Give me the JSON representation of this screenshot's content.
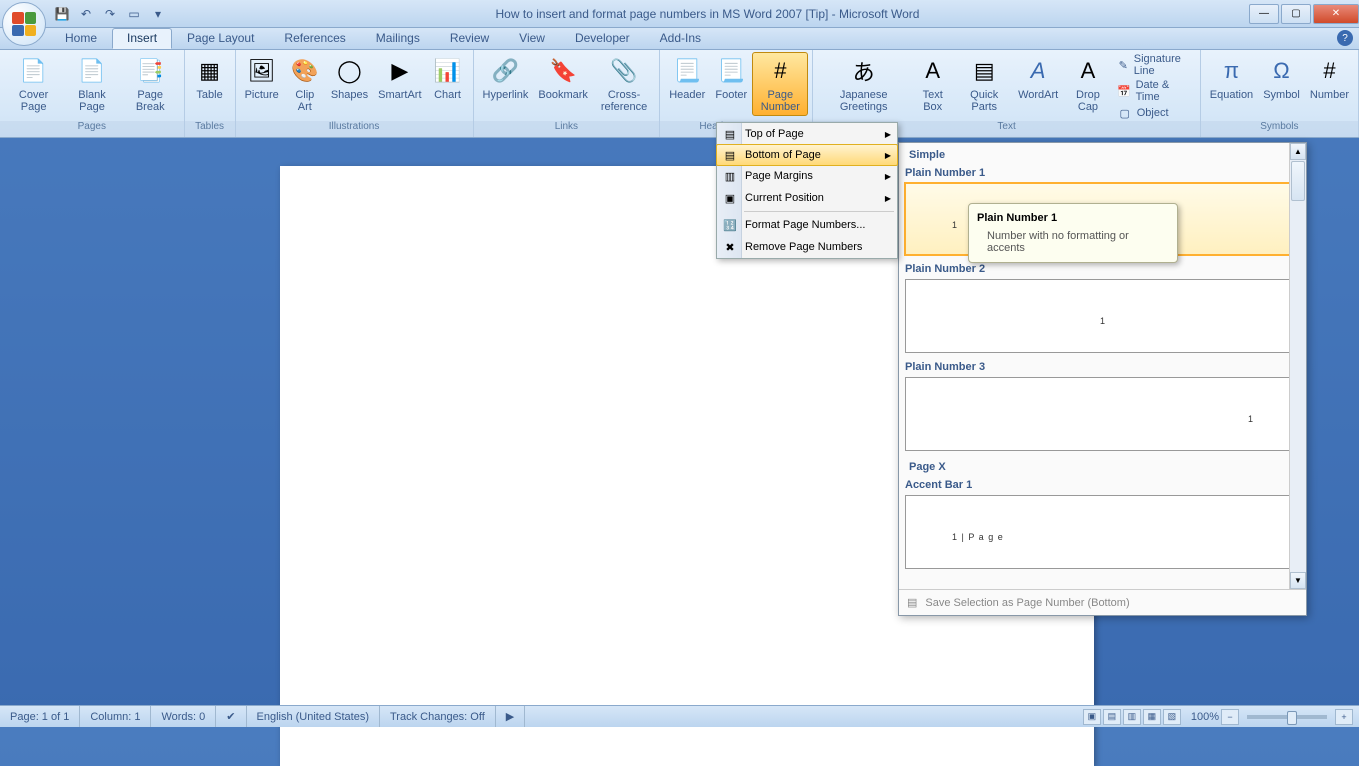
{
  "title": "How to insert and format page numbers in MS Word 2007 [Tip] - Microsoft Word",
  "tabs": [
    "Home",
    "Insert",
    "Page Layout",
    "References",
    "Mailings",
    "Review",
    "View",
    "Developer",
    "Add-Ins"
  ],
  "active_tab": "Insert",
  "ribbon": {
    "pages": {
      "label": "Pages",
      "cover": "Cover Page",
      "blank": "Blank Page",
      "break": "Page Break"
    },
    "tables": {
      "label": "Tables",
      "table": "Table"
    },
    "illustrations": {
      "label": "Illustrations",
      "picture": "Picture",
      "clip": "Clip Art",
      "shapes": "Shapes",
      "smartart": "SmartArt",
      "chart": "Chart"
    },
    "links": {
      "label": "Links",
      "hyper": "Hyperlink",
      "bookmark": "Bookmark",
      "crossref": "Cross-reference"
    },
    "hf": {
      "label": "Header & Footer",
      "header": "Header",
      "footer": "Footer",
      "pagenum": "Page Number"
    },
    "text": {
      "label": "Text",
      "jp": "Japanese Greetings",
      "textbox": "Text Box",
      "quick": "Quick Parts",
      "wordart": "WordArt",
      "dropcap": "Drop Cap",
      "sig": "Signature Line",
      "date": "Date & Time",
      "object": "Object"
    },
    "symbols": {
      "label": "Symbols",
      "eq": "Equation",
      "symbol": "Symbol",
      "number": "Number"
    }
  },
  "dropdown": {
    "top": "Top of Page",
    "bottom": "Bottom of Page",
    "margins": "Page Margins",
    "current": "Current Position",
    "format": "Format Page Numbers...",
    "remove": "Remove Page Numbers"
  },
  "gallery": {
    "cat1": "Simple",
    "p1": "Plain Number 1",
    "p2": "Plain Number 2",
    "p3": "Plain Number 3",
    "cat2": "Page X",
    "a1": "Accent Bar 1",
    "accent_text": "1 | P a g e",
    "save": "Save Selection as Page Number (Bottom)"
  },
  "tooltip": {
    "title": "Plain Number 1",
    "body": "Number with no formatting or accents"
  },
  "statusbar": {
    "page": "Page: 1 of 1",
    "col": "Column: 1",
    "words": "Words: 0",
    "lang": "English (United States)",
    "track": "Track Changes: Off",
    "zoom": "100%"
  }
}
